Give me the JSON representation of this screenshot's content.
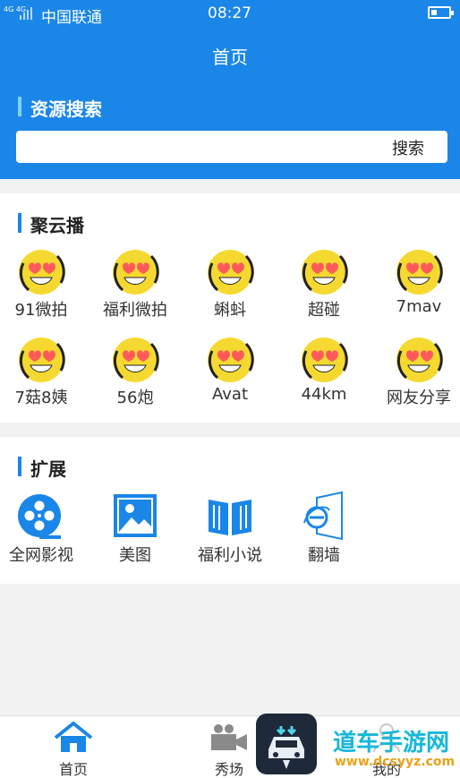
{
  "status_bar": {
    "network": "4G 4G",
    "carrier": "中国联通",
    "time": "08:27"
  },
  "header": {
    "title": "首页"
  },
  "search": {
    "section_title": "资源搜索",
    "input_value": "",
    "button_label": "搜索"
  },
  "juyunbo": {
    "title": "聚云播",
    "items": [
      {
        "label": "91微拍",
        "icon": "heart-eyes-emoji-icon"
      },
      {
        "label": "福利微拍",
        "icon": "heart-eyes-emoji-icon"
      },
      {
        "label": "蝌蚪",
        "icon": "heart-eyes-emoji-icon"
      },
      {
        "label": "超碰",
        "icon": "heart-eyes-emoji-icon"
      },
      {
        "label": "7mav",
        "icon": "heart-eyes-emoji-icon"
      },
      {
        "label": "7菇8姨",
        "icon": "heart-eyes-emoji-icon"
      },
      {
        "label": "56炮",
        "icon": "heart-eyes-emoji-icon"
      },
      {
        "label": "Avat",
        "icon": "heart-eyes-emoji-icon"
      },
      {
        "label": "44km",
        "icon": "heart-eyes-emoji-icon"
      },
      {
        "label": "网友分享",
        "icon": "heart-eyes-emoji-icon"
      }
    ]
  },
  "kuozhan": {
    "title": "扩展",
    "items": [
      {
        "label": "全网影视",
        "icon": "film-reel-icon"
      },
      {
        "label": "美图",
        "icon": "picture-icon"
      },
      {
        "label": "福利小说",
        "icon": "open-book-icon"
      },
      {
        "label": "翻墙",
        "icon": "internet-explorer-icon"
      }
    ]
  },
  "tabs": [
    {
      "label": "首页",
      "icon": "home-icon"
    },
    {
      "label": "秀场",
      "icon": "video-camera-icon"
    },
    {
      "label": "我的",
      "icon": "user-icon"
    }
  ],
  "watermark": {
    "text": "道车手游网",
    "url": "www.dcsyyz.com"
  },
  "colors": {
    "primary": "#1a86e8",
    "emoji_yellow": "#f5d930",
    "heart_red": "#ff5a5a"
  }
}
